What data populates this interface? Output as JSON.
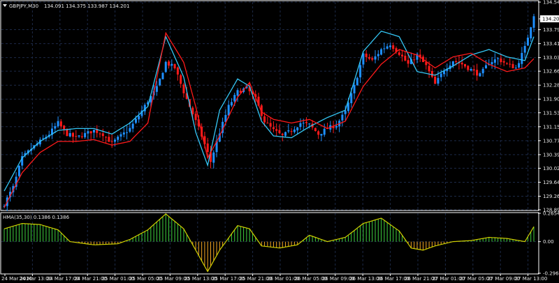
{
  "header": {
    "symbol_timeframe": "GBPJPY,M30",
    "ohlc": "134.091 134.375 133.987 134.201"
  },
  "current_price_label": "134.201",
  "subwindow": {
    "indicator_label": "HMA(35,30) 0.1386 0.1386"
  },
  "colors": {
    "background": "#000000",
    "grid": "#1d2a48",
    "frame": "#ffffff",
    "bull_candle": "#1e90ff",
    "bear_candle": "#ff1a1a",
    "upper_line": "#34c6f4",
    "lower_line": "#ff1a1a",
    "hist_positive": "#3fd13f",
    "hist_negative": "#f5a623",
    "signal_line": "#cfcf00"
  },
  "chart_data": [
    {
      "type": "candlestick",
      "y_axis_ticks": [
        134.54,
        134.201,
        133.79,
        133.41,
        133.03,
        132.66,
        132.28,
        131.9,
        131.53,
        131.15,
        130.77,
        130.39,
        130.02,
        129.64,
        129.26,
        128.89
      ],
      "ylim": [
        128.89,
        134.54
      ],
      "x_axis_ticks": [
        "24 Mar 2020",
        "24 Mar 13:00",
        "24 Mar 17:00",
        "24 Mar 21:00",
        "25 Mar 01:00",
        "25 Mar 05:00",
        "25 Mar 09:00",
        "25 Mar 13:00",
        "25 Mar 17:00",
        "25 Mar 21:00",
        "26 Mar 01:00",
        "26 Mar 05:00",
        "26 Mar 09:00",
        "26 Mar 13:00",
        "26 Mar 17:00",
        "26 Mar 21:00",
        "27 Mar 01:00",
        "27 Mar 05:00",
        "27 Mar 09:00",
        "27 Mar 13:00"
      ],
      "close_path": [
        [
          0,
          129.05
        ],
        [
          3,
          129.5
        ],
        [
          6,
          130.3
        ],
        [
          9,
          130.55
        ],
        [
          12,
          130.75
        ],
        [
          15,
          130.95
        ],
        [
          18,
          131.25
        ],
        [
          21,
          130.95
        ],
        [
          24,
          130.85
        ],
        [
          27,
          130.95
        ],
        [
          30,
          131.05
        ],
        [
          33,
          130.95
        ],
        [
          36,
          130.7
        ],
        [
          39,
          130.9
        ],
        [
          42,
          131.1
        ],
        [
          45,
          131.45
        ],
        [
          48,
          131.85
        ],
        [
          51,
          132.2
        ],
        [
          54,
          132.9
        ],
        [
          57,
          132.75
        ],
        [
          60,
          132.1
        ],
        [
          63,
          131.5
        ],
        [
          66,
          130.9
        ],
        [
          69,
          130.2
        ],
        [
          72,
          131.0
        ],
        [
          75,
          131.7
        ],
        [
          78,
          132.1
        ],
        [
          81,
          132.2
        ],
        [
          84,
          131.9
        ],
        [
          87,
          131.3
        ],
        [
          90,
          131.05
        ],
        [
          93,
          130.9
        ],
        [
          96,
          131.05
        ],
        [
          99,
          131.25
        ],
        [
          102,
          131.2
        ],
        [
          105,
          130.95
        ],
        [
          108,
          131.1
        ],
        [
          111,
          131.2
        ],
        [
          114,
          131.55
        ],
        [
          117,
          132.25
        ],
        [
          120,
          133.1
        ],
        [
          123,
          132.95
        ],
        [
          126,
          133.25
        ],
        [
          129,
          133.4
        ],
        [
          132,
          133.15
        ],
        [
          135,
          132.85
        ],
        [
          138,
          133.1
        ],
        [
          141,
          132.8
        ],
        [
          144,
          132.3
        ],
        [
          147,
          132.7
        ],
        [
          150,
          132.95
        ],
        [
          153,
          132.85
        ],
        [
          156,
          132.7
        ],
        [
          159,
          132.55
        ],
        [
          162,
          132.9
        ],
        [
          165,
          133.0
        ],
        [
          168,
          132.85
        ],
        [
          171,
          132.75
        ],
        [
          174,
          133.3
        ],
        [
          177,
          134.201
        ]
      ],
      "upper_line": [
        [
          0,
          129.4
        ],
        [
          6,
          130.3
        ],
        [
          12,
          130.75
        ],
        [
          18,
          131.05
        ],
        [
          24,
          131.1
        ],
        [
          30,
          131.1
        ],
        [
          36,
          130.95
        ],
        [
          42,
          131.25
        ],
        [
          48,
          131.7
        ],
        [
          54,
          133.6
        ],
        [
          60,
          132.5
        ],
        [
          64,
          131.0
        ],
        [
          68,
          130.1
        ],
        [
          72,
          131.6
        ],
        [
          78,
          132.45
        ],
        [
          82,
          132.25
        ],
        [
          86,
          131.3
        ],
        [
          90,
          130.9
        ],
        [
          96,
          130.85
        ],
        [
          102,
          131.15
        ],
        [
          108,
          131.4
        ],
        [
          114,
          131.6
        ],
        [
          120,
          133.2
        ],
        [
          126,
          133.75
        ],
        [
          132,
          133.6
        ],
        [
          138,
          132.65
        ],
        [
          144,
          132.55
        ],
        [
          150,
          132.8
        ],
        [
          156,
          133.1
        ],
        [
          162,
          133.25
        ],
        [
          168,
          133.05
        ],
        [
          174,
          132.95
        ],
        [
          177,
          133.6
        ]
      ],
      "lower_line": [
        [
          0,
          128.95
        ],
        [
          6,
          129.9
        ],
        [
          12,
          130.45
        ],
        [
          18,
          130.75
        ],
        [
          24,
          130.75
        ],
        [
          30,
          130.8
        ],
        [
          36,
          130.65
        ],
        [
          42,
          130.75
        ],
        [
          48,
          131.25
        ],
        [
          54,
          133.7
        ],
        [
          60,
          132.9
        ],
        [
          64,
          131.7
        ],
        [
          68,
          130.3
        ],
        [
          72,
          130.9
        ],
        [
          78,
          131.95
        ],
        [
          82,
          132.35
        ],
        [
          86,
          131.55
        ],
        [
          90,
          131.35
        ],
        [
          96,
          131.25
        ],
        [
          102,
          131.35
        ],
        [
          108,
          131.1
        ],
        [
          114,
          131.3
        ],
        [
          120,
          132.25
        ],
        [
          126,
          132.85
        ],
        [
          132,
          133.25
        ],
        [
          138,
          133.1
        ],
        [
          144,
          132.75
        ],
        [
          150,
          133.05
        ],
        [
          156,
          133.15
        ],
        [
          162,
          132.85
        ],
        [
          168,
          132.65
        ],
        [
          174,
          132.75
        ],
        [
          177,
          133.0
        ]
      ]
    },
    {
      "type": "histogram",
      "y_axis_ticks": [
        0.2654,
        0.0,
        -0.2961
      ],
      "ylim": [
        -0.2961,
        0.2654
      ],
      "values_path": [
        [
          0,
          0.12
        ],
        [
          6,
          0.17
        ],
        [
          12,
          0.16
        ],
        [
          18,
          0.11
        ],
        [
          22,
          0.0
        ],
        [
          30,
          -0.03
        ],
        [
          38,
          -0.02
        ],
        [
          42,
          0.02
        ],
        [
          48,
          0.11
        ],
        [
          54,
          0.26
        ],
        [
          60,
          0.12
        ],
        [
          64,
          -0.08
        ],
        [
          68,
          -0.28
        ],
        [
          72,
          -0.08
        ],
        [
          78,
          0.15
        ],
        [
          82,
          0.12
        ],
        [
          86,
          -0.04
        ],
        [
          92,
          -0.06
        ],
        [
          98,
          -0.03
        ],
        [
          102,
          0.06
        ],
        [
          108,
          0.0
        ],
        [
          114,
          0.04
        ],
        [
          120,
          0.17
        ],
        [
          126,
          0.22
        ],
        [
          132,
          0.1
        ],
        [
          136,
          -0.06
        ],
        [
          140,
          -0.08
        ],
        [
          144,
          -0.04
        ],
        [
          150,
          0.0
        ],
        [
          156,
          0.01
        ],
        [
          162,
          0.04
        ],
        [
          168,
          0.03
        ],
        [
          174,
          0.0
        ],
        [
          177,
          0.14
        ]
      ]
    }
  ]
}
